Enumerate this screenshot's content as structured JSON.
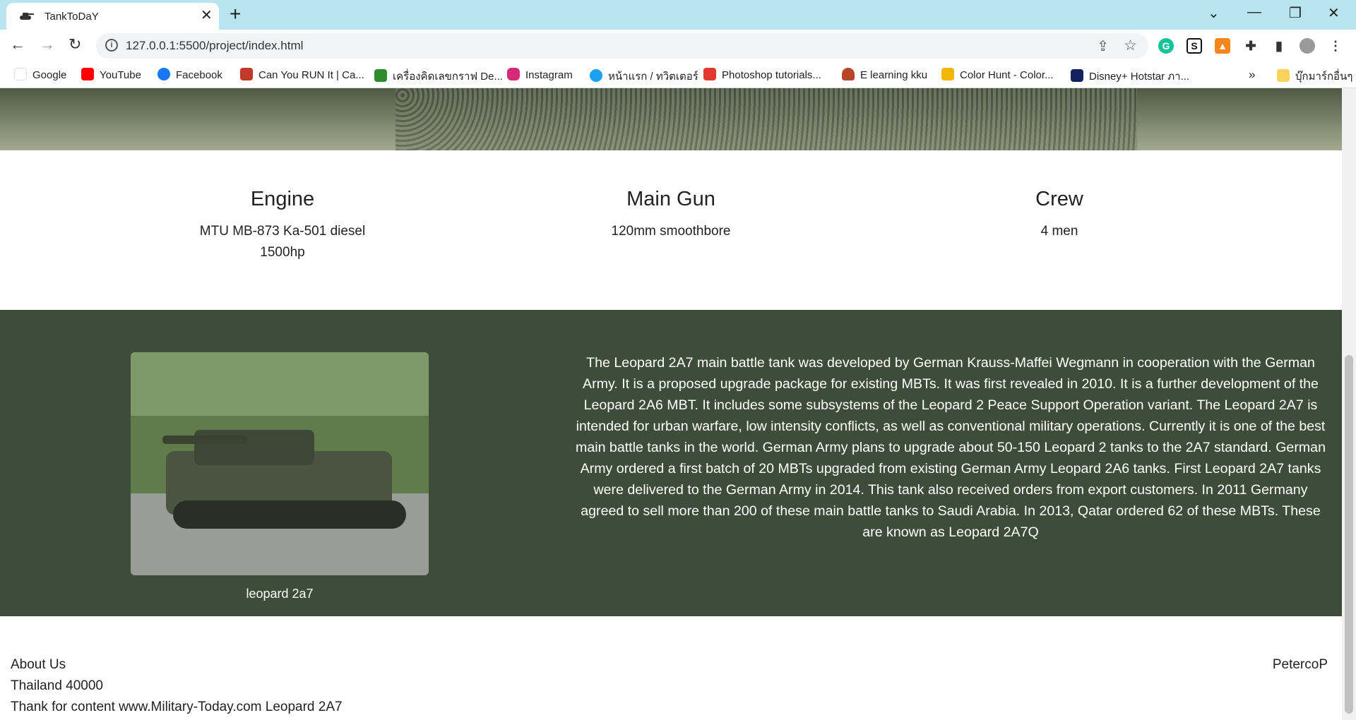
{
  "browser": {
    "tab_title": "TankToDaY",
    "url": "127.0.0.1:5500/project/index.html",
    "bookmarks": [
      {
        "label": "Google",
        "color": "#ffffff"
      },
      {
        "label": "YouTube",
        "color": "#ff0000"
      },
      {
        "label": "Facebook",
        "color": "#1877f2"
      },
      {
        "label": "Can You RUN It | Ca...",
        "color": "#c0392b"
      },
      {
        "label": "เครื่องคิดเลขกราฟ De...",
        "color": "#2e8b2e"
      },
      {
        "label": "Instagram",
        "color": "#d62976"
      },
      {
        "label": "หน้าแรก / ทวิตเตอร์",
        "color": "#1da1f2"
      },
      {
        "label": "Photoshop tutorials...",
        "color": "#e03a2f"
      },
      {
        "label": "E learning kku",
        "color": "#b5462a"
      },
      {
        "label": "Color Hunt - Color...",
        "color": "#f2b705"
      },
      {
        "label": "Disney+ Hotstar ภา...",
        "color": "#13215f"
      }
    ],
    "other_bookmarks": "บุ๊กมาร์กอื่นๆ"
  },
  "specs": [
    {
      "title": "Engine",
      "line1": "MTU MB-873 Ka-501 diesel",
      "line2": "1500hp"
    },
    {
      "title": "Main Gun",
      "line1": "120mm smoothbore",
      "line2": ""
    },
    {
      "title": "Crew",
      "line1": "4 men",
      "line2": ""
    }
  ],
  "about": {
    "image_caption": "leopard 2a7",
    "description": "The Leopard 2A7 main battle tank was developed by German Krauss-Maffei Wegmann in cooperation with the German Army. It is a proposed upgrade package for existing MBTs. It was first revealed in 2010. It is a further development of the Leopard 2A6 MBT. It includes some subsystems of the Leopard 2 Peace Support Operation variant. The Leopard 2A7 is intended for urban warfare, low intensity conflicts, as well as conventional military operations. Currently it is one of the best main battle tanks in the world. German Army plans to upgrade about 50-150 Leopard 2 tanks to the 2A7 standard. German Army ordered a first batch of 20 MBTs upgraded from existing German Army Leopard 2A6 tanks. First Leopard 2A7 tanks were delivered to the German Army in 2014. This tank also received orders from export customers. In 2011 Germany agreed to sell more than 200 of these main battle tanks to Saudi Arabia. In 2013, Qatar ordered 62 of these MBTs. These are known as Leopard 2A7Q"
  },
  "footer": {
    "about_us": "About Us",
    "address": "Thailand 40000",
    "credit": "Thank for content www.Military-Today.com Leopard 2A7",
    "author": "PetercoP"
  },
  "colors": {
    "titlebar": "#b7e4ef",
    "about_bg": "#3e4d3a"
  }
}
